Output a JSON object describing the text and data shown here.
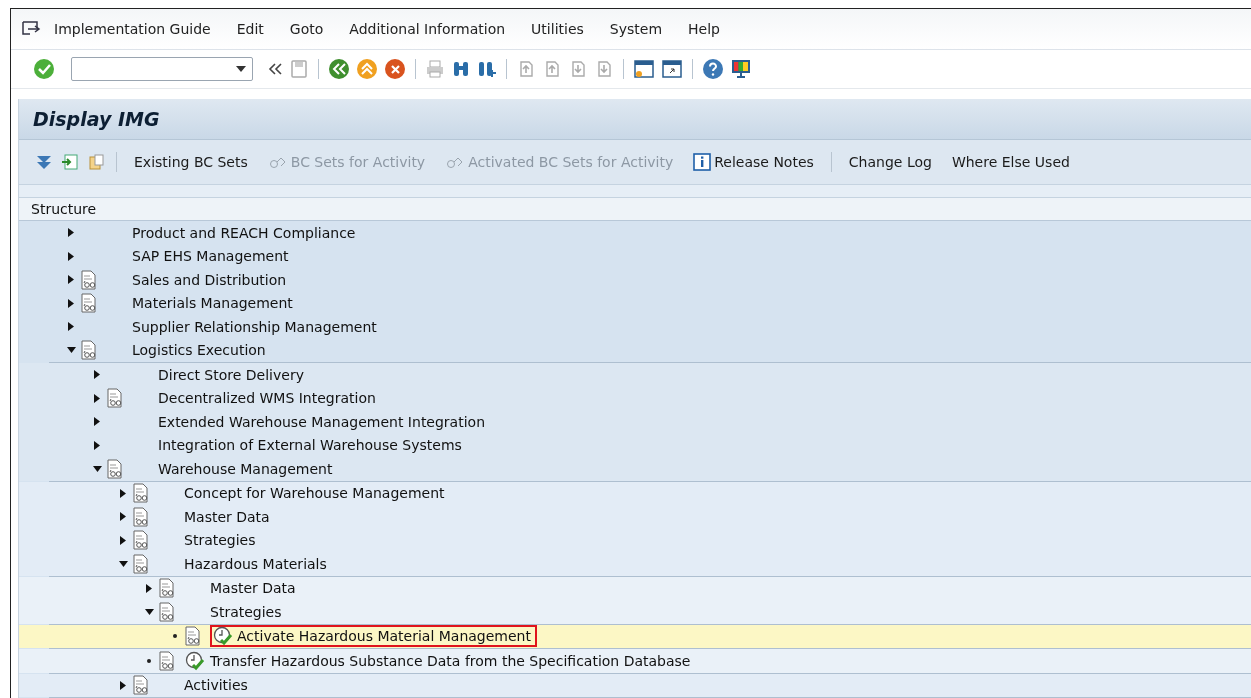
{
  "menu_bar": {
    "items": [
      "Implementation Guide",
      "Edit",
      "Goto",
      "Additional Information",
      "Utilities",
      "System",
      "Help"
    ]
  },
  "command_field": {
    "kind": "dropdown"
  },
  "screen_title": "Display IMG",
  "app_toolbar": {
    "buttons": [
      {
        "label": "Existing BC Sets",
        "disabled": false,
        "kind": "text"
      },
      {
        "label": "BC Sets for Activity",
        "disabled": true,
        "kind": "bcset"
      },
      {
        "label": "Activated BC Sets for Activity",
        "disabled": true,
        "kind": "bcset"
      },
      {
        "label": "Release Notes",
        "disabled": false,
        "kind": "info"
      },
      {
        "label": "Change Log",
        "disabled": false,
        "kind": "text"
      },
      {
        "label": "Where Else Used",
        "disabled": false,
        "kind": "text"
      }
    ]
  },
  "tree": {
    "header": "Structure",
    "nodes": [
      {
        "label": "Product and REACH Compliance",
        "kind": "folder",
        "expanded": false,
        "has_docs": false,
        "selected": false
      },
      {
        "label": "SAP EHS Management",
        "kind": "folder",
        "expanded": false,
        "has_docs": false,
        "selected": false
      },
      {
        "label": "Sales and Distribution",
        "kind": "folder",
        "expanded": false,
        "has_docs": true,
        "selected": false
      },
      {
        "label": "Materials Management",
        "kind": "folder",
        "expanded": false,
        "has_docs": true,
        "selected": false
      },
      {
        "label": "Supplier Relationship Management",
        "kind": "folder",
        "expanded": false,
        "has_docs": false,
        "selected": false
      },
      {
        "label": "Logistics Execution",
        "kind": "folder",
        "expanded": true,
        "has_docs": true,
        "selected": false,
        "children": [
          {
            "label": "Direct Store Delivery",
            "kind": "folder",
            "expanded": false,
            "has_docs": false,
            "selected": false
          },
          {
            "label": "Decentralized WMS Integration",
            "kind": "folder",
            "expanded": false,
            "has_docs": true,
            "selected": false
          },
          {
            "label": "Extended Warehouse Management Integration",
            "kind": "folder",
            "expanded": false,
            "has_docs": false,
            "selected": false
          },
          {
            "label": "Integration of External Warehouse Systems",
            "kind": "folder",
            "expanded": false,
            "has_docs": false,
            "selected": false
          },
          {
            "label": "Warehouse Management",
            "kind": "folder",
            "expanded": true,
            "has_docs": true,
            "selected": false,
            "children": [
              {
                "label": "Concept for Warehouse Management",
                "kind": "folder",
                "expanded": false,
                "has_docs": true,
                "selected": false
              },
              {
                "label": "Master Data",
                "kind": "folder",
                "expanded": false,
                "has_docs": true,
                "selected": false
              },
              {
                "label": "Strategies",
                "kind": "folder",
                "expanded": false,
                "has_docs": true,
                "selected": false
              },
              {
                "label": "Hazardous Materials",
                "kind": "folder",
                "expanded": true,
                "has_docs": true,
                "selected": false,
                "children": [
                  {
                    "label": "Master Data",
                    "kind": "folder",
                    "expanded": false,
                    "has_docs": true,
                    "selected": false
                  },
                  {
                    "label": "Strategies",
                    "kind": "folder",
                    "expanded": true,
                    "has_docs": true,
                    "selected": false,
                    "children": [
                      {
                        "label": "Activate Hazardous Material Management",
                        "kind": "activity",
                        "has_docs": true,
                        "selected": true,
                        "highlighted": true
                      }
                    ]
                  },
                  {
                    "label": "Transfer Hazardous Substance Data from the Specification Database",
                    "kind": "activity",
                    "has_docs": true,
                    "selected": false,
                    "highlighted": false
                  }
                ]
              },
              {
                "label": "Activities",
                "kind": "folder",
                "expanded": false,
                "has_docs": true,
                "selected": false
              }
            ]
          }
        ]
      }
    ]
  }
}
